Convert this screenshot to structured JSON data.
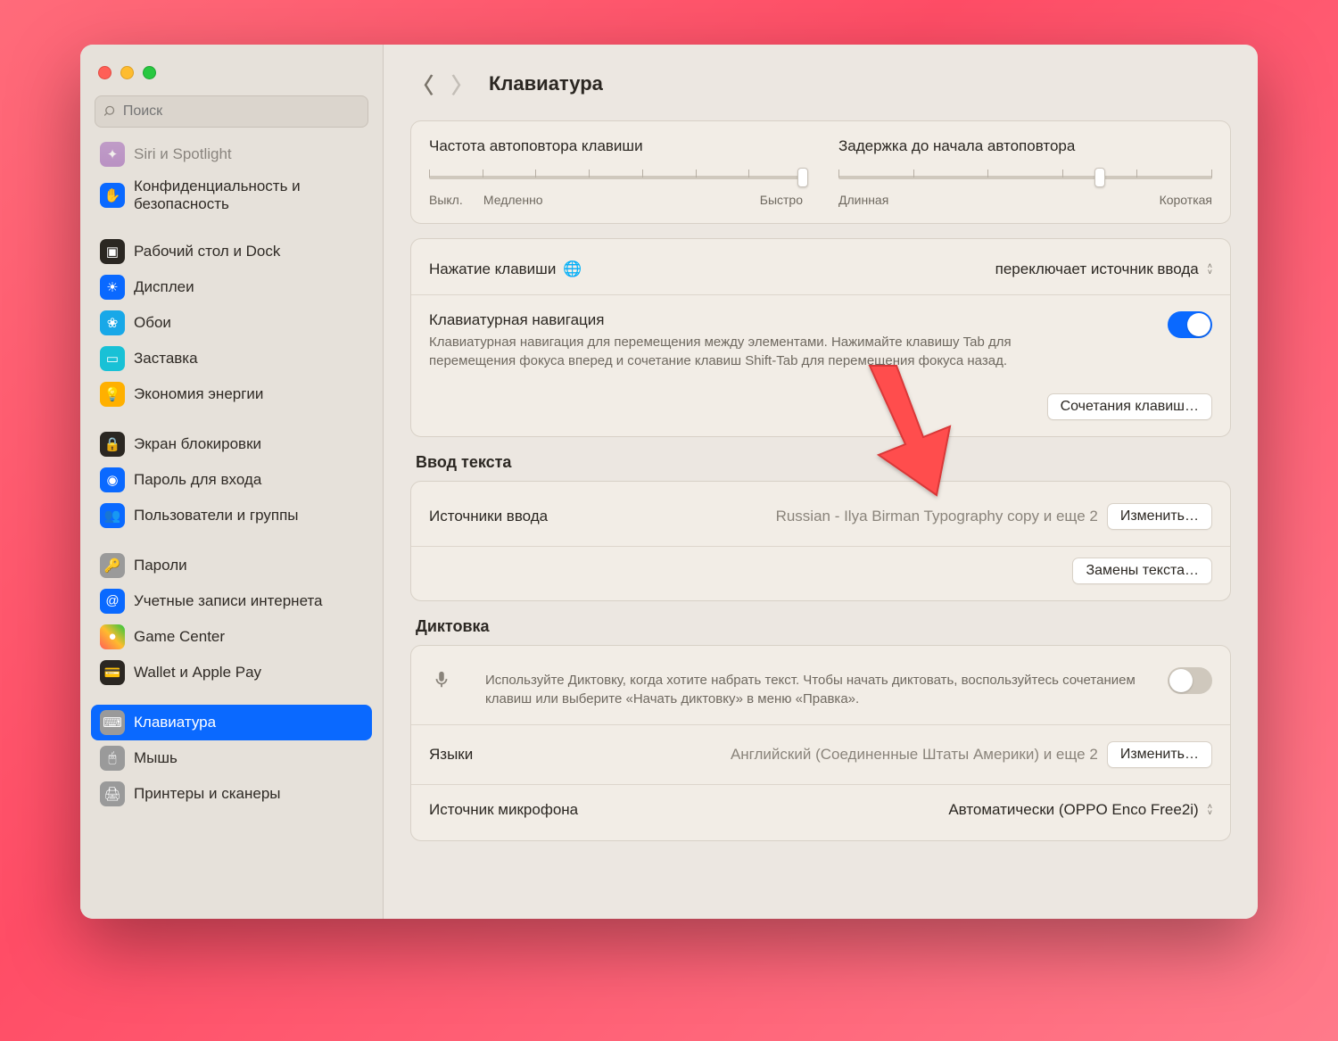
{
  "header": {
    "title": "Клавиатура"
  },
  "search": {
    "placeholder": "Поиск"
  },
  "sidebar": {
    "items": [
      "Siri и Spotlight",
      "Конфиденциальность и безопасность",
      "Рабочий стол и Dock",
      "Дисплеи",
      "Обои",
      "Заставка",
      "Экономия энергии",
      "Экран блокировки",
      "Пароль для входа",
      "Пользователи и группы",
      "Пароли",
      "Учетные записи интернета",
      "Game Center",
      "Wallet и Apple Pay",
      "Клавиатура",
      "Мышь",
      "Принтеры и сканеры"
    ]
  },
  "repeat": {
    "rate_label": "Частота автоповтора клавиши",
    "rate_min": "Выкл.",
    "rate_mid": "Медленно",
    "rate_max": "Быстро",
    "delay_label": "Задержка до начала автоповтора",
    "delay_min": "Длинная",
    "delay_max": "Короткая"
  },
  "globe": {
    "label": "Нажатие клавиши",
    "value": "переключает источник ввода"
  },
  "keynav": {
    "label": "Клавиатурная навигация",
    "desc": "Клавиатурная навигация для перемещения между элементами. Нажимайте клавишу Tab для перемещения фокуса вперед и сочетание клавиш Shift-Tab для перемещения фокуса назад.",
    "shortcuts_btn": "Сочетания клавиш…"
  },
  "text_input": {
    "section": "Ввод текста",
    "sources_label": "Источники ввода",
    "sources_value": "Russian - Ilya Birman Typography copy и еще 2",
    "edit_btn": "Изменить…",
    "replace_btn": "Замены текста…"
  },
  "dictation": {
    "section": "Диктовка",
    "desc": "Используйте Диктовку, когда хотите набрать текст. Чтобы начать диктовать, воспользуйтесь сочетанием клавиш или выберите «Начать диктовку» в меню «Правка».",
    "lang_label": "Языки",
    "lang_value": "Английский (Соединенные Штаты Америки) и еще 2",
    "edit_btn": "Изменить…",
    "mic_label": "Источник микрофона",
    "mic_value": "Автоматически (OPPO Enco Free2i)"
  }
}
